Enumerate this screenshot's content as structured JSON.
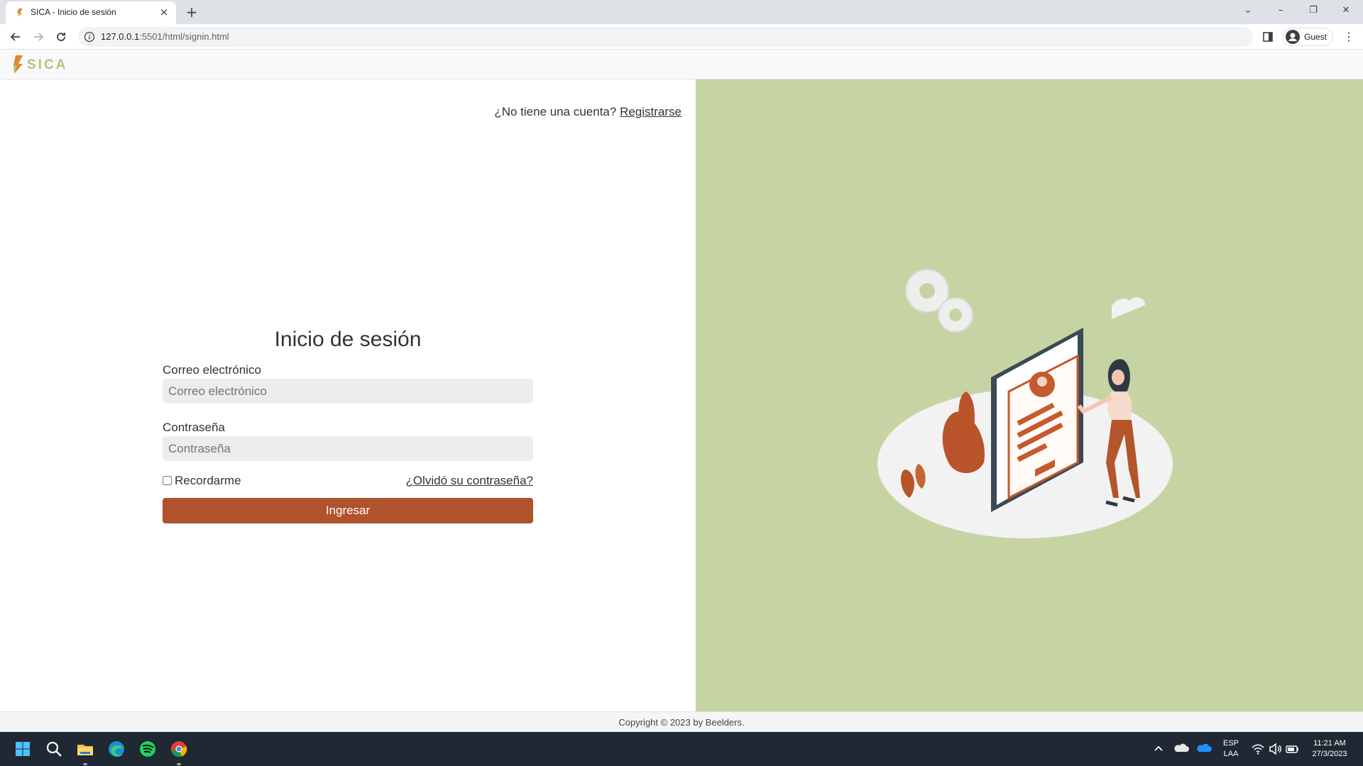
{
  "browser": {
    "tab_title": "SICA - Inicio de sesión",
    "tab_close": "×",
    "new_tab": "+",
    "url_host": "127.0.0.1",
    "url_rest": ":5501/html/signin.html",
    "profile_label": "Guest",
    "window_controls": {
      "list": "⌄",
      "minimize": "–",
      "restore": "❐",
      "close": "✕"
    }
  },
  "header": {
    "brand": "SICA"
  },
  "auth": {
    "register_prompt": "¿No tiene una cuenta?",
    "register_link": "Registrarse"
  },
  "login": {
    "title": "Inicio de sesión",
    "email_label": "Correo electrónico",
    "email_placeholder": "Correo electrónico",
    "password_label": "Contraseña",
    "password_placeholder": "Contraseña",
    "remember_label": "Recordarme",
    "forgot_link": "¿Olvidó su contraseña?",
    "submit_label": "Ingresar"
  },
  "footer": {
    "copyright": "Copyright © 2023 by Beelders."
  },
  "taskbar": {
    "language_top": "ESP",
    "language_bottom": "LAA",
    "time": "11:21 AM",
    "date": "27/3/2023"
  },
  "colors": {
    "accent": "#b0522c",
    "illustration_bg": "#c6d4a4",
    "brand_green": "#b3c47a"
  }
}
